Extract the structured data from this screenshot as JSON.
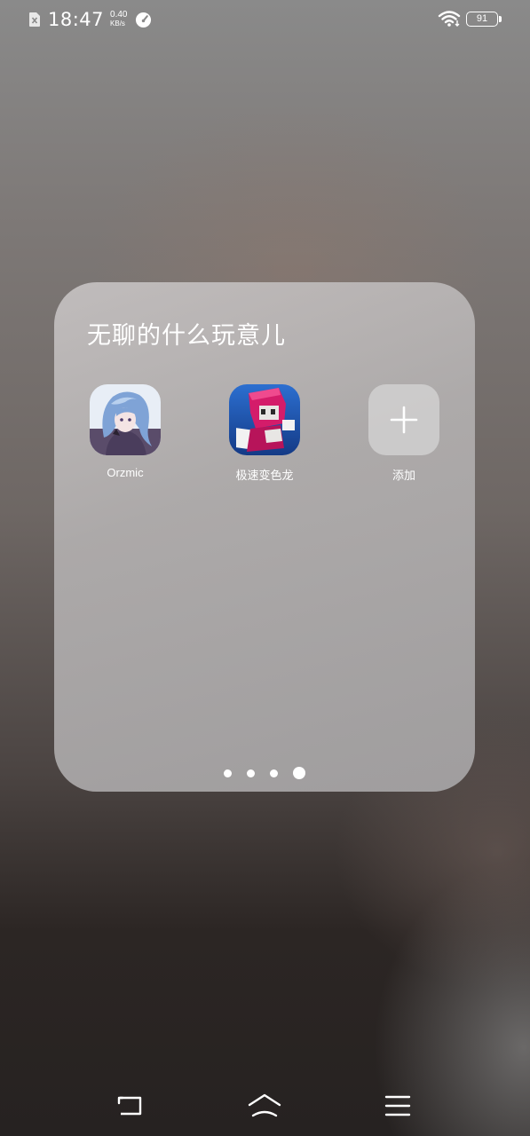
{
  "status_bar": {
    "time": "18:47",
    "net_speed_value": "0.40",
    "net_speed_unit": "KB/s",
    "battery_level": "91",
    "icons": [
      "sim-error-icon",
      "speed-gauge-icon",
      "wifi-icon",
      "battery-icon"
    ]
  },
  "folder": {
    "title": "无聊的什么玩意儿",
    "apps": [
      {
        "label": "Orzmic",
        "icon": "orzmic-app-icon"
      },
      {
        "label": "极速变色龙",
        "icon": "chameleon-run-app-icon"
      },
      {
        "label": "添加",
        "icon": "add-icon"
      }
    ],
    "pages": 4,
    "current_page": 4
  },
  "nav_bar": {
    "icons": [
      "back-icon",
      "home-icon",
      "menu-icon"
    ]
  },
  "colors": {
    "text": "#ffffff",
    "folder_bg": "#b4b1b1",
    "chameleon_pink": "#d41c6a"
  }
}
